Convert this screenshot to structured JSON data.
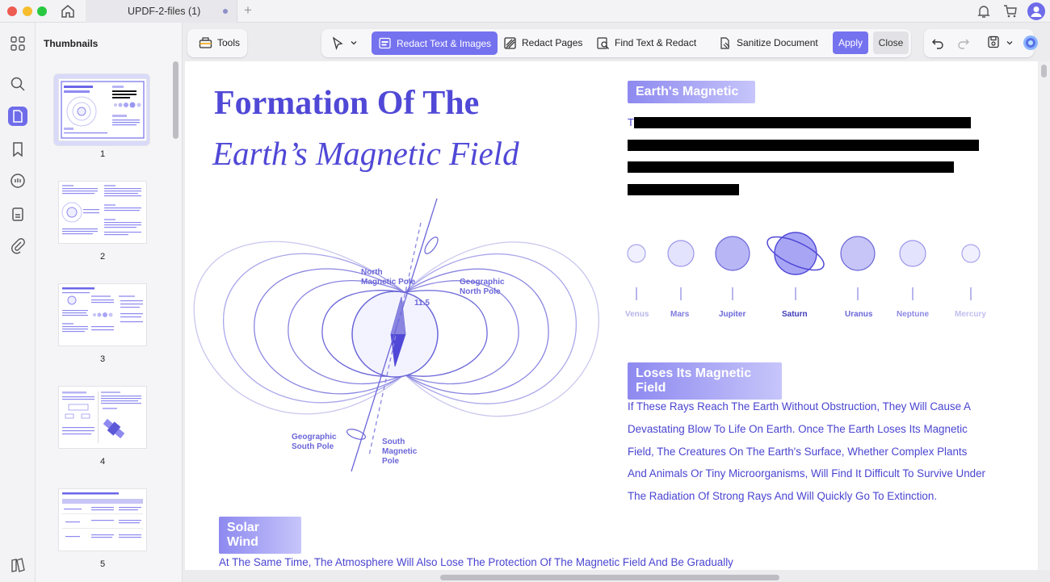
{
  "window": {
    "tab_title": "UPDF-2-files (1)",
    "tab_add": "+"
  },
  "sidebar": {
    "title": "Thumbnails",
    "pages": [
      "1",
      "2",
      "3",
      "4",
      "5"
    ]
  },
  "toolbar": {
    "tools": "Tools",
    "redact_text_images": "Redact Text & Images",
    "redact_pages": "Redact Pages",
    "find_text_redact": "Find Text & Redact",
    "sanitize_document": "Sanitize Document",
    "apply": "Apply",
    "close": "Close"
  },
  "document": {
    "title_line1": "Formation Of The",
    "title_line2": "Earth’s Magnetic Field",
    "diagram": {
      "north_magnetic": "North\nMagnetic Pole",
      "north_magnetic_l1": "North",
      "north_magnetic_l2": "Magnetic Pole",
      "geo_north_l1": "Geographic",
      "geo_north_l2": "North Pole",
      "angle": "11.5",
      "geo_south_l1": "Geographic",
      "geo_south_l2": "South Pole",
      "south_mag_l1": "South",
      "south_mag_l2": "Magnetic",
      "south_mag_l3": "Pole"
    },
    "section1_heading": "Earth's Magnetic",
    "redacted_first_char": "T",
    "planets": [
      "Venus",
      "Mars",
      "Jupiter",
      "Saturn",
      "Uranus",
      "Neptune",
      "Mercury"
    ],
    "section2_heading": "Loses Its Magnetic Field",
    "section2_body": "If These Rays Reach The Earth Without Obstruction, They Will Cause A Devastating Blow To Life On Earth. Once The Earth Loses Its Magnetic Field, The Creatures On The Earth's Surface, Whether Complex Plants And Animals Or Tiny Microorganisms, Will Find It Difficult To Survive Under The Radiation Of Strong Rays And Will Quickly Go To Extinction.",
    "section3_heading": "Solar Wind",
    "section3_body": "At The Same Time, The Atmosphere Will Also Lose The Protection Of The Magnetic Field And Be Gradually"
  },
  "colors": {
    "accent": "#7572ef",
    "text_purple": "#4a44d0",
    "title_purple": "#5048d6"
  }
}
